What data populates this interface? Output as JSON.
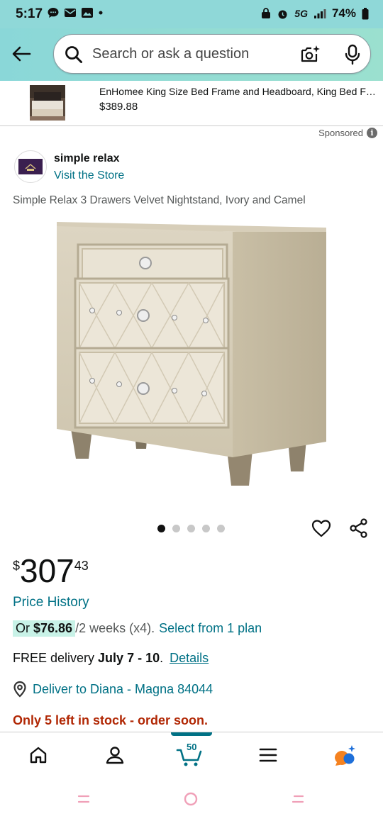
{
  "status_bar": {
    "time": "5:17",
    "network": "5G",
    "battery": "74%"
  },
  "search": {
    "placeholder": "Search or ask a question"
  },
  "sponsored_banner": {
    "title": "EnHomee King Size Bed Frame and Headboard, King Bed Frame with Storage",
    "price": "$389.88"
  },
  "sponsored_label": "Sponsored",
  "store": {
    "name": "simple relax",
    "visit_label": "Visit the Store"
  },
  "product": {
    "title": "Simple Relax 3 Drawers Velvet Nightstand, Ivory and Camel",
    "image_count": 5,
    "active_image": 1
  },
  "price": {
    "currency": "$",
    "whole": "307",
    "fraction": "43"
  },
  "price_history_label": "Price History",
  "installment": {
    "prefix": "Or ",
    "amount": "$76.86",
    "suffix": " /2 weeks (x4).",
    "link": "Select from 1 plan"
  },
  "delivery": {
    "prefix": "FREE delivery ",
    "dates": "July 7 - 10",
    "period": ".",
    "link": "Details"
  },
  "deliver_to": "Deliver to Diana - Magna 84044",
  "stock_message": "Only 5 left in stock - order soon.",
  "bottom_nav": {
    "cart_count": "50"
  },
  "colors": {
    "header_teal": "#8ad7d8",
    "link": "#007185",
    "stock_red": "#b12704",
    "installment_bg": "#c8f2e7"
  }
}
